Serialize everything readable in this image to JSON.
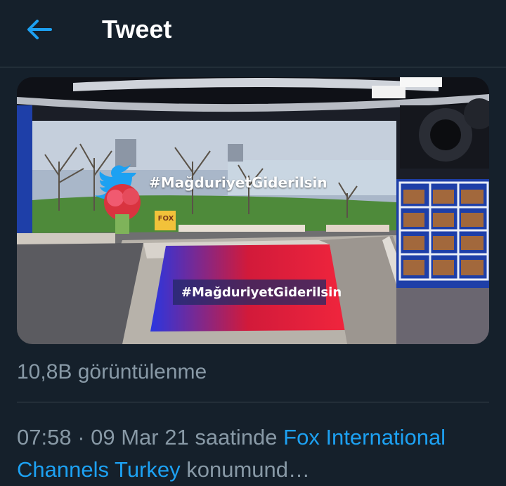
{
  "header": {
    "title": "Tweet",
    "back_icon": "arrow-left-icon"
  },
  "media": {
    "screen_hashtag": "#MağduriyetGiderilsin",
    "desk_hashtag": "#MağduriyetGiderilsin",
    "desk_logo": "FOX"
  },
  "views": {
    "text": "10,8B görüntülenme"
  },
  "meta": {
    "time": "07:58",
    "sep": " · ",
    "date": "09 Mar 21",
    "saatinde": " saatinde ",
    "location": "Fox International Channels Turkey",
    "konumunda": " konumund…"
  },
  "colors": {
    "background": "#15202b",
    "accent": "#1da1f2",
    "muted": "#8899a6",
    "divider": "#38444d"
  }
}
